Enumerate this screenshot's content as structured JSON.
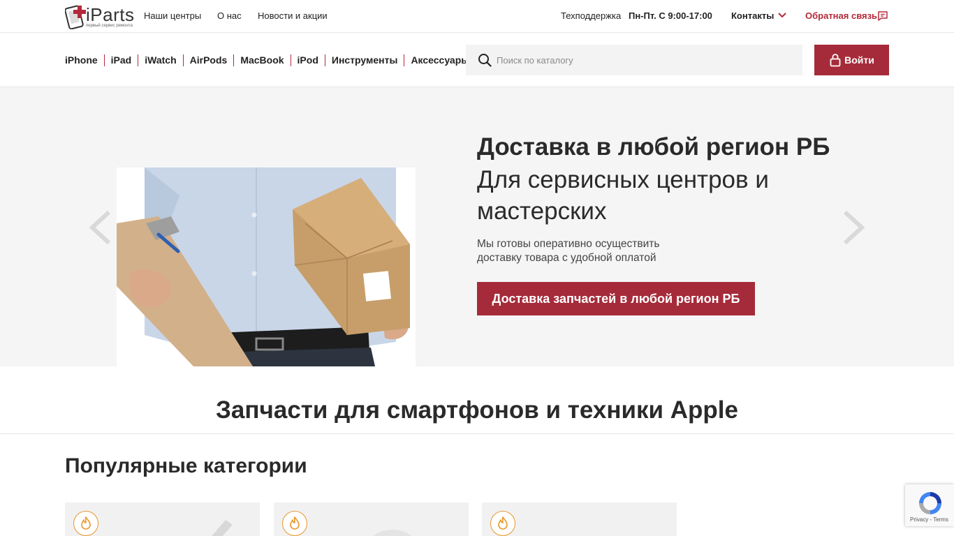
{
  "logo": {
    "text": "iParts",
    "tagline": "первый сервис ремонта"
  },
  "topnav": [
    {
      "label": "Наши центры"
    },
    {
      "label": "О нас"
    },
    {
      "label": "Новости и акции"
    }
  ],
  "support": {
    "label": "Техподдержка",
    "hours": "Пн-Пт. С 9:00-17:00"
  },
  "contacts_label": "Контакты",
  "feedback_label": "Обратная связь",
  "categories": [
    "iPhone",
    "iPad",
    "iWatch",
    "AirPods",
    "MacBook",
    "iPod",
    "Инструменты",
    "Аксессуары"
  ],
  "search": {
    "placeholder": "Поиск по каталогу",
    "value": ""
  },
  "login_label": "Войти",
  "hero": {
    "title": "Доставка в любой регион РБ",
    "subtitle": "Для сервисных центров и мастерских",
    "description": "Мы готовы оперативно осуществить доставку товара с удобной оплатой",
    "button": "Доставка запчастей в любой регион РБ"
  },
  "section_title": "Запчасти для смартфонов и техники Apple",
  "popular_title": "Популярные категории",
  "recaptcha": {
    "links": "Privacy - Terms"
  },
  "colors": {
    "accent": "#a62b3a",
    "fire": "#e8962e",
    "hero_bg": "#f5f5f5"
  },
  "icons": [
    "search-icon",
    "lock-icon",
    "chevron-down-icon",
    "chat-icon",
    "arrow-left-icon",
    "arrow-right-icon",
    "fire-icon",
    "recaptcha-icon"
  ]
}
